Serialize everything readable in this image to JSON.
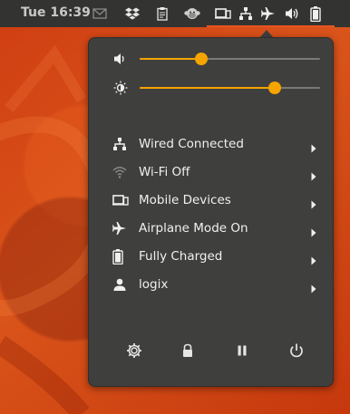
{
  "topbar": {
    "clock": "Tue 16:39",
    "tray_icons": [
      "email-icon",
      "dropbox-icon",
      "clipboard-icon",
      "monkey-icon",
      "mobile-devices-icon",
      "network-icon",
      "airplane-icon",
      "volume-icon",
      "battery-icon"
    ]
  },
  "menu": {
    "sliders": [
      {
        "name": "volume",
        "icon": "volume-icon",
        "level_percent": 34
      },
      {
        "name": "brightness",
        "icon": "brightness-icon",
        "level_percent": 75
      }
    ],
    "items": [
      {
        "label": "Wired Connected",
        "icon": "network-wired-icon"
      },
      {
        "label": "Wi-Fi Off",
        "icon": "wifi-icon"
      },
      {
        "label": "Mobile Devices",
        "icon": "mobile-devices-icon"
      },
      {
        "label": "Airplane Mode On",
        "icon": "airplane-icon"
      },
      {
        "label": "Fully Charged",
        "icon": "battery-icon"
      },
      {
        "label": "logix",
        "icon": "user-icon"
      }
    ],
    "bottom_buttons": [
      {
        "name": "settings",
        "icon": "settings-icon"
      },
      {
        "name": "lock",
        "icon": "lock-icon"
      },
      {
        "name": "suspend",
        "icon": "pause-icon"
      },
      {
        "name": "power",
        "icon": "power-icon"
      }
    ]
  },
  "colors": {
    "panel": "#333431",
    "menu_background": "#3f3f3e",
    "accent_orange": "#e95420",
    "slider_fill": "#f5a400",
    "wallpaper": "#d1420f"
  }
}
